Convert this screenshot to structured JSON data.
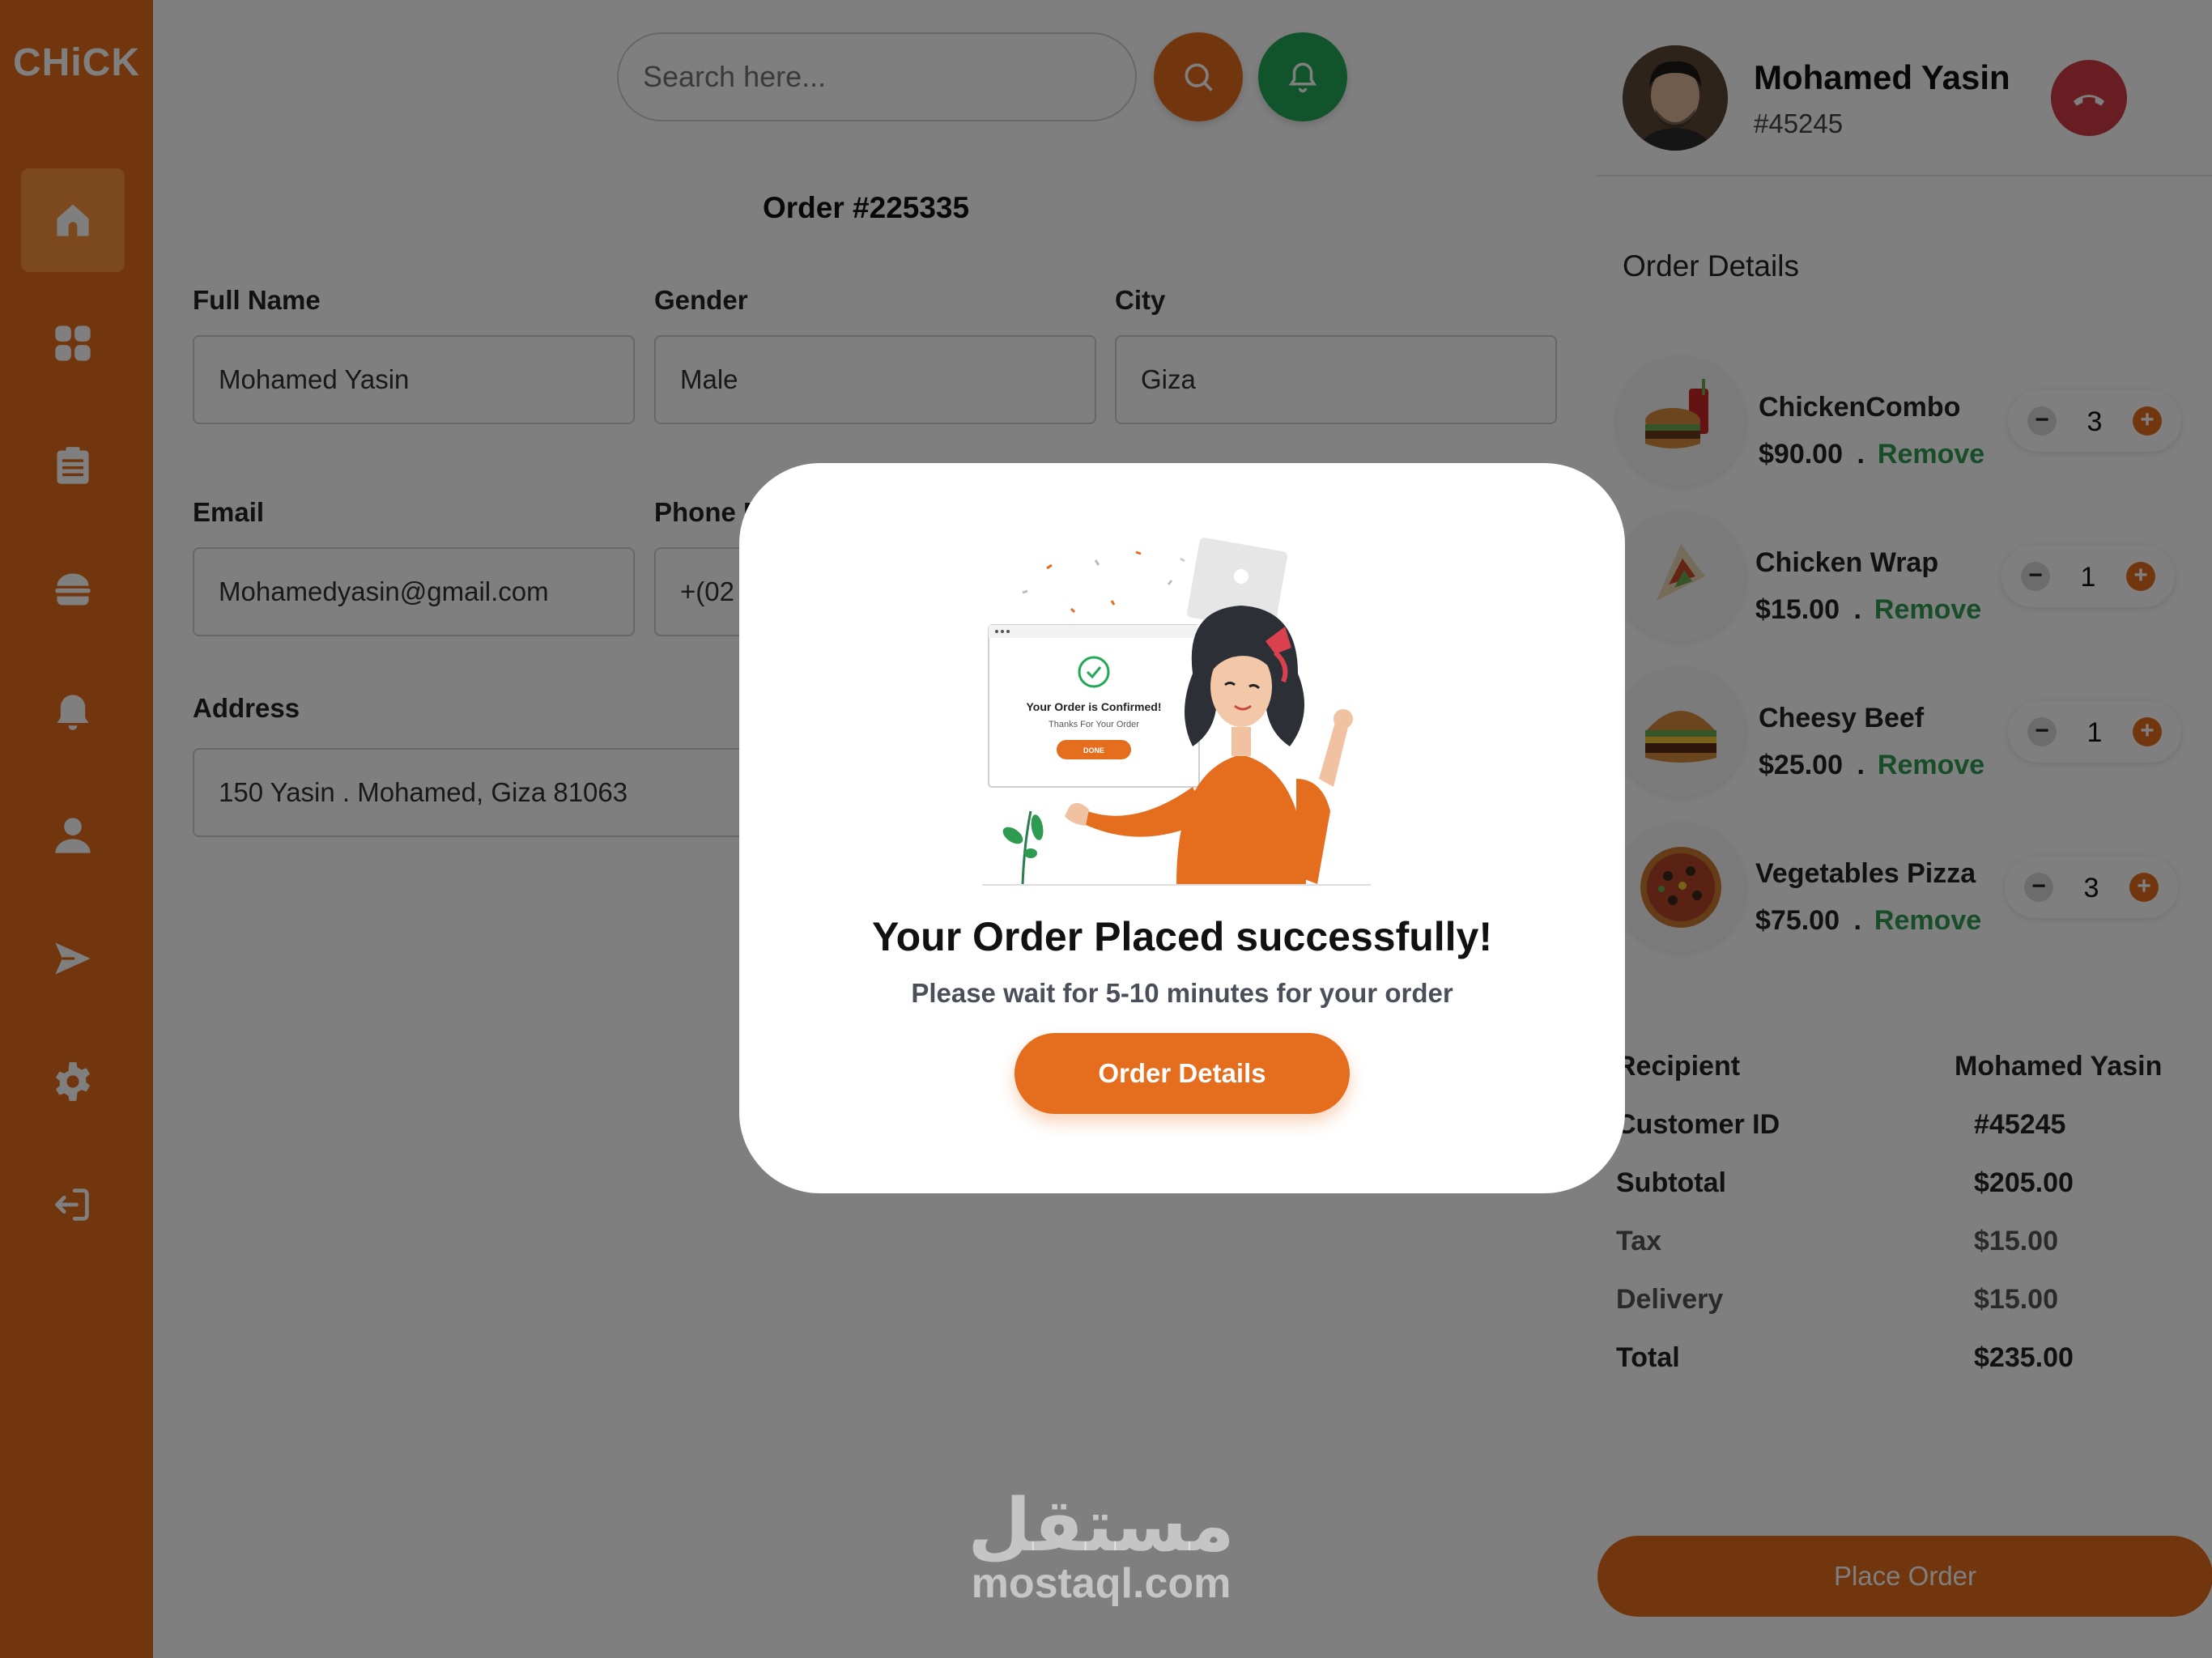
{
  "app": {
    "logo": "CHiCK"
  },
  "sidebar": {
    "items": [
      {
        "name": "home-icon",
        "active": true
      },
      {
        "name": "grid-icon"
      },
      {
        "name": "clipboard-icon"
      },
      {
        "name": "burger-icon"
      },
      {
        "name": "bell-icon"
      },
      {
        "name": "user-icon"
      },
      {
        "name": "send-icon"
      },
      {
        "name": "gear-icon"
      },
      {
        "name": "logout-icon"
      }
    ]
  },
  "header": {
    "search_placeholder": "Search here...",
    "search_button_color": "#e46d1e",
    "notification_button_color": "#22a956"
  },
  "form": {
    "order_title": "Order #225335",
    "full_name_label": "Full Name",
    "full_name_value": "Mohamed Yasin",
    "gender_label": "Gender",
    "gender_value": "Male",
    "city_label": "City",
    "city_value": "Giza",
    "email_label": "Email",
    "email_value": "Mohamedyasin@gmail.com",
    "phone_label": "Phone N",
    "phone_value": "+(02",
    "address_label": "Address",
    "address_value": "150 Yasin . Mohamed, Giza 81063"
  },
  "user": {
    "name": "Mohamed Yasin",
    "id": "#45245"
  },
  "order_details": {
    "title": "Order Details",
    "remove_label": "Remove",
    "items": [
      {
        "name": "ChickenCombo",
        "price": "$90.00",
        "qty": "3"
      },
      {
        "name": "Chicken Wrap",
        "price": "$15.00",
        "qty": "1"
      },
      {
        "name": "Cheesy  Beef",
        "price": "$25.00",
        "qty": "1"
      },
      {
        "name": "Vegetables Pizza",
        "price": "$75.00",
        "qty": "3"
      }
    ]
  },
  "summary": {
    "recipient_label": "Recipient",
    "recipient_value": "Mohamed Yasin",
    "customer_id_label": "Customer ID",
    "customer_id_value": "#45245",
    "subtotal_label": "Subtotal",
    "subtotal_value": "$205.00",
    "tax_label": "Tax",
    "tax_value": "$15.00",
    "delivery_label": "Delivery",
    "delivery_value": "$15.00",
    "total_label": "Total",
    "total_value": "$235.00"
  },
  "place_order_label": "Place Order",
  "modal": {
    "illustration_card_title": "Your Order is Confirmed!",
    "illustration_card_sub": "Thanks For Your Order",
    "illustration_card_button": "DONE",
    "title": "Your Order Placed successfully!",
    "subtitle": "Please wait for 5-10 minutes for your order",
    "button_label": "Order Details"
  },
  "watermark": {
    "arabic": "مستقل",
    "latin": "mostaql.com"
  },
  "colors": {
    "accent": "#e46d1e",
    "green": "#2e9a52",
    "danger": "#d03a45"
  }
}
